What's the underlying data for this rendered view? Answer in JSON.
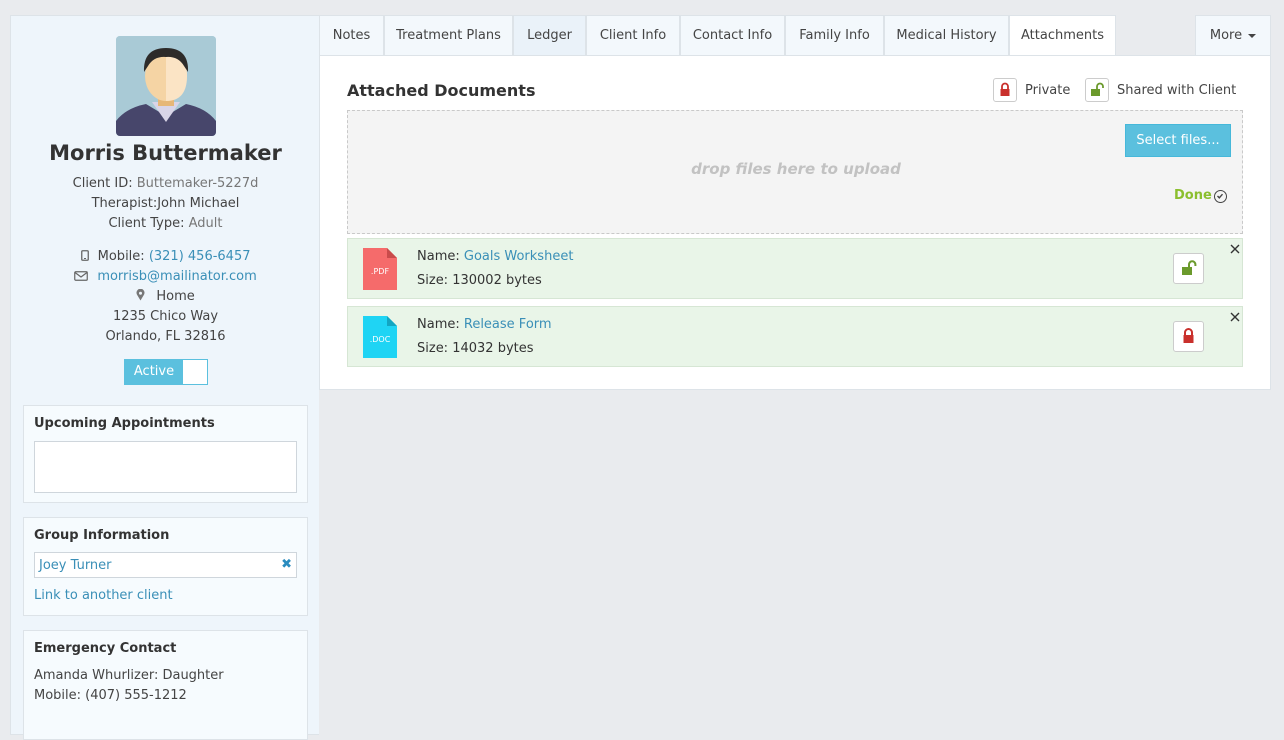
{
  "client": {
    "name": "Morris Buttermaker",
    "id_label": "Client ID:",
    "id_value": "Buttemaker-5227d",
    "therapist_label": "Therapist:",
    "therapist_value": "John Michael",
    "type_label": "Client Type:",
    "type_value": "Adult",
    "mobile_label": "Mobile:",
    "mobile_value": "(321) 456-6457",
    "email": "morrisb@mailinator.com",
    "address_label": "Home",
    "address_line1": "1235 Chico Way",
    "address_line2": "Orlando, FL 32816",
    "status_label": "Active"
  },
  "panels": {
    "appointments_title": "Upcoming Appointments",
    "group_title": "Group Information",
    "group_member": "Joey Turner",
    "link_client": "Link to another client",
    "emergency_title": "Emergency Contact",
    "emergency_name": "Amanda Whurlizer: Daughter",
    "emergency_mobile": "Mobile: (407) 555-1212"
  },
  "tabs": [
    "Notes",
    "Treatment Plans",
    "Ledger",
    "Client Info",
    "Contact Info",
    "Family Info",
    "Medical History",
    "Attachments",
    "More"
  ],
  "attachments": {
    "title": "Attached Documents",
    "legend_private": "Private",
    "legend_shared": "Shared with Client",
    "select_files": "Select files...",
    "drop_text": "drop files here to upload",
    "done": "Done",
    "name_label": "Name:",
    "size_label": "Size:",
    "files": [
      {
        "ext": ".PDF",
        "name": "Goals Worksheet",
        "size": "130002 bytes",
        "shared": true
      },
      {
        "ext": ".DOC",
        "name": "Release Form",
        "size": "14032 bytes",
        "shared": false
      }
    ]
  },
  "colors": {
    "accent": "#5bc0de",
    "link": "#3a8fb7",
    "pdf": "#f56b6b",
    "doc": "#1fd4f4",
    "lock_private": "#c9302c",
    "lock_shared": "#6b9a2c",
    "done": "#8bbf2e"
  },
  "icons": {
    "mobile": "mobile-icon",
    "email": "envelope-icon",
    "address": "map-marker-icon",
    "remove": "x-mark-icon",
    "private": "lock-icon",
    "shared": "unlock-icon",
    "done": "check-circle-icon",
    "close": "close-icon"
  }
}
